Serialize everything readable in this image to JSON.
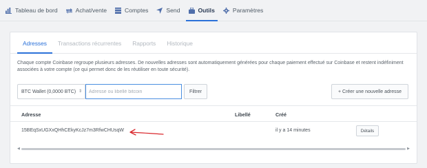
{
  "nav": {
    "items": [
      {
        "label": "Tableau de bord",
        "icon": "dashboard-icon"
      },
      {
        "label": "Achat/vente",
        "icon": "exchange-icon"
      },
      {
        "label": "Comptes",
        "icon": "accounts-icon"
      },
      {
        "label": "Send",
        "icon": "send-icon"
      },
      {
        "label": "Outils",
        "icon": "toolbox-icon"
      },
      {
        "label": "Paramètres",
        "icon": "gear-icon"
      }
    ],
    "active": "Outils"
  },
  "tabs": [
    "Adresses",
    "Transactions récurrentes",
    "Rapports",
    "Historique"
  ],
  "description": "Chaque compte Coinbase regroupe plusieurs adresses. De nouvelles adresses sont automatiquement générées pour chaque paiement effectué sur Coinbase et restent indéfiniment associées à votre compte (ce qui permet donc de les réutiliser en toute sécurité).",
  "controls": {
    "wallet_select": "BTC Wallet (0,0000 BTC)",
    "search_placeholder": "Adresse ou libellé bitcoin",
    "filter_label": "Filtrer",
    "create_label": "+ Créer une nouvelle adresse"
  },
  "table": {
    "headers": {
      "address": "Adresse",
      "label": "Libellé",
      "created": "Créé"
    },
    "rows": [
      {
        "address": "15BEqSxUGXxQHhCEkyKcJz7m3RfwCHUsqW",
        "label": "",
        "created": "il y a 14 minutes",
        "action": "Détails"
      }
    ]
  },
  "colors": {
    "accent": "#2b71d9",
    "annotation": "#d9262b"
  }
}
